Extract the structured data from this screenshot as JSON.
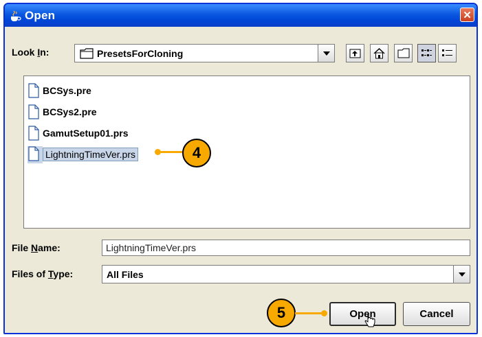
{
  "window": {
    "title": "Open",
    "close_glyph": "✕"
  },
  "lookin": {
    "label_prefix": "Look ",
    "label_mnemonic": "I",
    "label_suffix": "n:",
    "value": "PresetsForCloning"
  },
  "toolbar": {
    "buttons": [
      {
        "name": "up-one-level-icon"
      },
      {
        "name": "home-icon"
      },
      {
        "name": "new-folder-icon"
      },
      {
        "name": "list-view-icon",
        "pressed": true
      },
      {
        "name": "details-view-icon"
      }
    ]
  },
  "files": [
    {
      "name": "BCSys.pre"
    },
    {
      "name": "BCSys2.pre"
    },
    {
      "name": "GamutSetup01.prs"
    },
    {
      "name": "LightningTimeVer.prs",
      "selected": true
    }
  ],
  "filename": {
    "label_prefix": "File ",
    "label_mnemonic": "N",
    "label_suffix": "ame:",
    "value": "LightningTimeVer.prs"
  },
  "filetype": {
    "label_prefix": "Files of ",
    "label_mnemonic": "T",
    "label_suffix": "ype:",
    "value": "All Files"
  },
  "buttons": {
    "open_prefix": "Op",
    "open_rest": "en",
    "cancel": "Cancel"
  },
  "callouts": {
    "step4": "4",
    "step5": "5"
  },
  "colors": {
    "accent": "#f7a900",
    "titlebar": "#0a58e0",
    "selection": "#c9d6ea",
    "dialog_bg": "#ece9d8"
  }
}
